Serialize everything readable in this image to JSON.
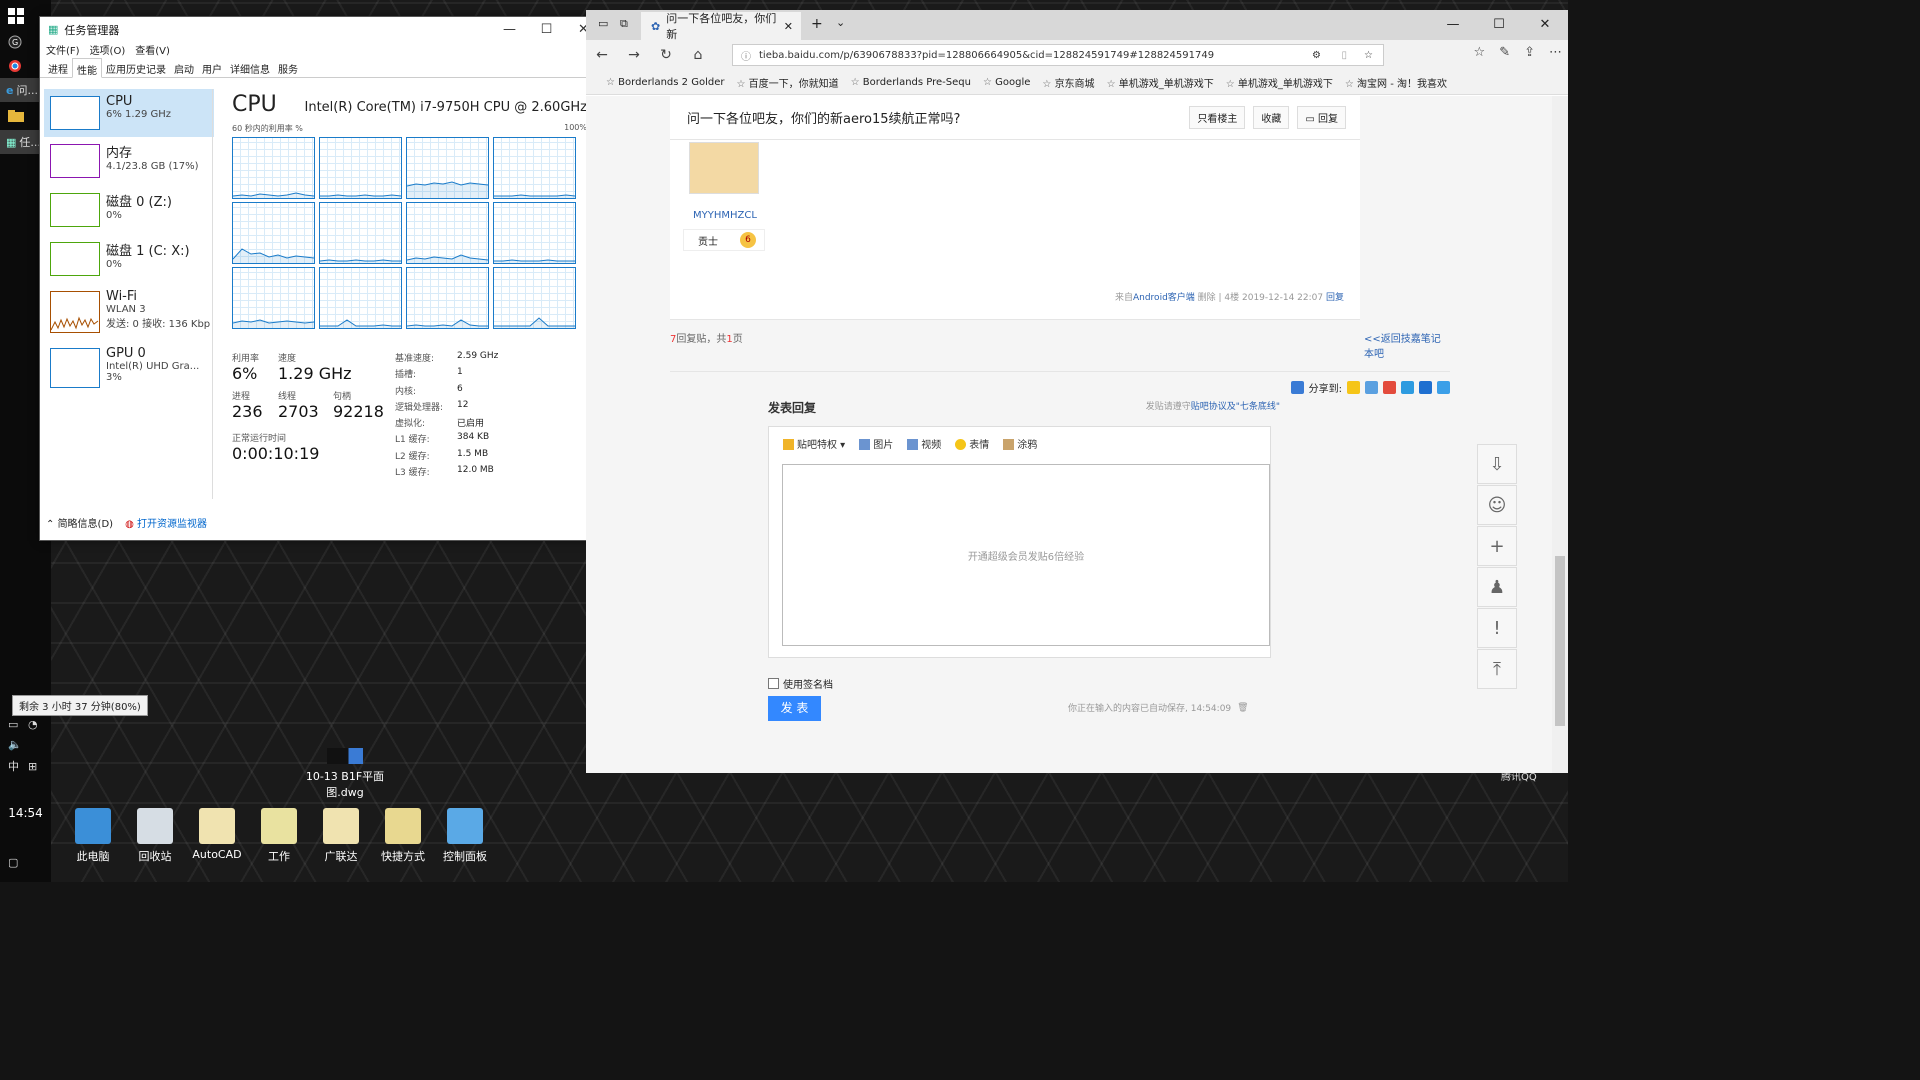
{
  "task_manager": {
    "title": "任务管理器",
    "menu": [
      "文件(F)",
      "选项(O)",
      "查看(V)"
    ],
    "tabs": [
      "进程",
      "性能",
      "应用历史记录",
      "启动",
      "用户",
      "详细信息",
      "服务"
    ],
    "active_tab": "性能",
    "sidebar": [
      {
        "name": "CPU",
        "detail": "6% 1.29 GHz",
        "detail2": "",
        "color": "#1a7bc9"
      },
      {
        "name": "内存",
        "detail": "4.1/23.8 GB (17%)",
        "detail2": "",
        "color": "#8b16b0"
      },
      {
        "name": "磁盘 0 (Z:)",
        "detail": "0%",
        "detail2": "",
        "color": "#4da60c"
      },
      {
        "name": "磁盘 1 (C: X:)",
        "detail": "0%",
        "detail2": "",
        "color": "#4da60c"
      },
      {
        "name": "Wi-Fi",
        "detail": "WLAN 3",
        "detail2": "发送: 0 接收: 136 Kbp",
        "color": "#a74f01"
      },
      {
        "name": "GPU 0",
        "detail": "Intel(R) UHD Gra...",
        "detail2": "3%",
        "color": "#1a7bc9"
      }
    ],
    "cpu_title": "CPU",
    "cpu_model": "Intel(R) Core(TM) i7-9750H CPU @ 2.60GHz",
    "graph_label_left": "60 秒内的利用率 %",
    "graph_label_right": "100%",
    "stats": {
      "util_label": "利用率",
      "util_value": "6%",
      "speed_label": "速度",
      "speed_value": "1.29 GHz",
      "proc_label": "进程",
      "proc_value": "236",
      "thread_label": "线程",
      "thread_value": "2703",
      "handle_label": "句柄",
      "handle_value": "92218",
      "uptime_label": "正常运行时间",
      "uptime_value": "0:00:10:19"
    },
    "details": [
      {
        "k": "基准速度:",
        "v": "2.59 GHz"
      },
      {
        "k": "插槽:",
        "v": "1"
      },
      {
        "k": "内核:",
        "v": "6"
      },
      {
        "k": "逻辑处理器:",
        "v": "12"
      },
      {
        "k": "虚拟化:",
        "v": "已启用"
      },
      {
        "k": "L1 缓存:",
        "v": "384 KB"
      },
      {
        "k": "L2 缓存:",
        "v": "1.5 MB"
      },
      {
        "k": "L3 缓存:",
        "v": "12.0 MB"
      }
    ],
    "footer_brief": "简略信息(D)",
    "footer_monitor": "打开资源监视器"
  },
  "browser": {
    "tab_title": "问一下各位吧友，你们新",
    "url": "tieba.baidu.com/p/6390678833?pid=128806664905&cid=128824591749#128824591749",
    "favorites": [
      "Borderlands 2 Golder",
      "百度一下，你就知道",
      "Borderlands Pre-Sequ",
      "Google",
      "京东商城",
      "单机游戏_单机游戏下",
      "单机游戏_单机游戏下",
      "淘宝网 - 淘！我喜欢"
    ],
    "post_title": "问一下各位吧友，你们的新aero15续航正常吗?",
    "btn_only_op": "只看楼主",
    "btn_fav": "收藏",
    "btn_reply": "回复",
    "username": "MYYHMHZCL",
    "user_rank": "贡士",
    "user_level": "6",
    "tail_prefix": "来自",
    "tail_client": "Android客户端",
    "tail_rest": "删除 | 4楼  2019-12-14 22:07",
    "tail_reply": "回复",
    "reply_count": "7",
    "reply_count_text": "回复贴，共",
    "page_count": "1",
    "page_unit": "页",
    "back_link": "<<返回技嘉笔记本吧",
    "share_label": "分享到:",
    "compose_title": "发表回复",
    "compose_note_pre": "发贴请遵守",
    "compose_note_link": "贴吧协议及\"七条底线\"",
    "editor_tools": [
      "贴吧特权",
      "图片",
      "视频",
      "表情",
      "涂鸦"
    ],
    "editor_placeholder": "开通超级会员发贴6倍经验",
    "signature_label": "使用签名档",
    "send_label": "发 表",
    "autosave_text": "你正在输入的内容已自动保存, 14:54:09"
  },
  "taskbar": {
    "time": "14:54",
    "ime": "中",
    "battery_tip": "剩余 3 小时 37 分钟(80%)",
    "window_label_1": "问...",
    "window_label_2": "任..."
  },
  "desktop": {
    "file_label": "10-13 B1F平面图.dwg",
    "icons": [
      "此电脑",
      "回收站",
      "AutoCAD",
      "工作",
      "广联达",
      "快捷方式",
      "控制面板"
    ],
    "qq_label": "腾讯QQ"
  }
}
